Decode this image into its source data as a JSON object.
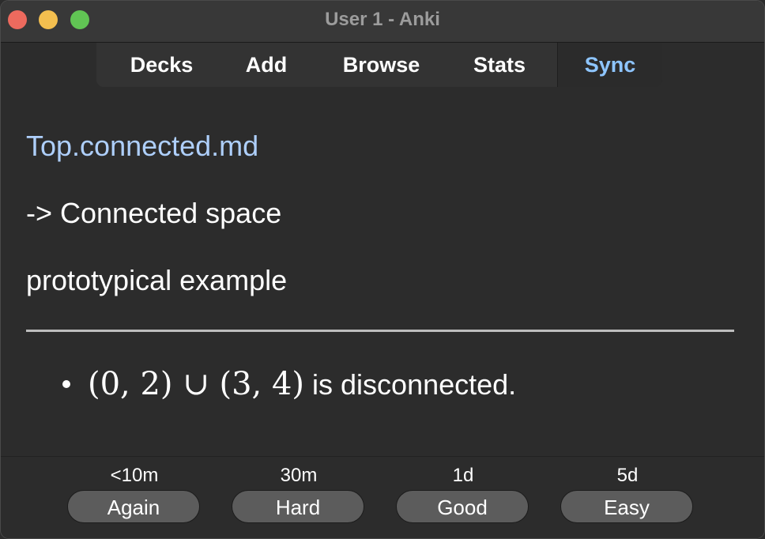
{
  "window": {
    "title": "User 1 - Anki"
  },
  "toolbar": {
    "items": [
      {
        "label": "Decks"
      },
      {
        "label": "Add"
      },
      {
        "label": "Browse"
      },
      {
        "label": "Stats"
      },
      {
        "label": "Sync",
        "active": true
      }
    ]
  },
  "card": {
    "filename": "Top.connected.md",
    "front": "-> Connected space",
    "prompt": "prototypical example",
    "answer": {
      "math": "(0, 2) ∪ (3, 4)",
      "text": " is disconnected."
    }
  },
  "answer_buttons": [
    {
      "interval": "<10m",
      "label": "Again"
    },
    {
      "interval": "30m",
      "label": "Hard"
    },
    {
      "interval": "1d",
      "label": "Good"
    },
    {
      "interval": "5d",
      "label": "Easy"
    }
  ],
  "colors": {
    "link": "#aecffb",
    "sync_accent": "#8ec5ff",
    "background": "#2c2c2c"
  }
}
